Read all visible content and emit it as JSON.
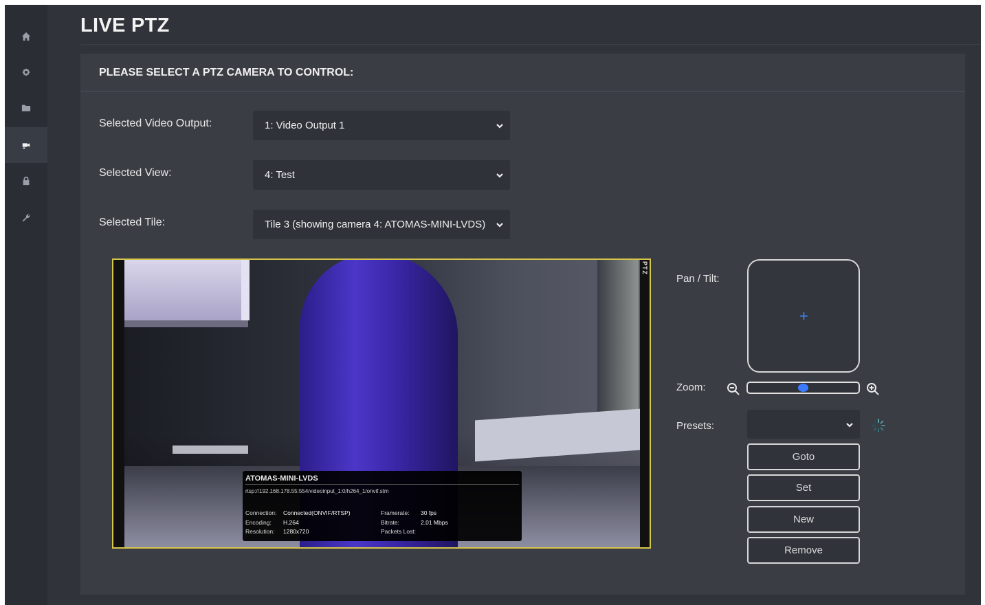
{
  "page": {
    "title": "LIVE PTZ"
  },
  "sidebar": {
    "items": [
      {
        "icon": "home-icon",
        "active": false
      },
      {
        "icon": "gear-icon",
        "active": false
      },
      {
        "icon": "folder-icon",
        "active": false
      },
      {
        "icon": "camera-icon",
        "active": true
      },
      {
        "icon": "lock-icon",
        "active": false
      },
      {
        "icon": "wrench-icon",
        "active": false
      }
    ]
  },
  "panel": {
    "heading": "PLEASE SELECT A PTZ CAMERA TO CONTROL:",
    "video_output": {
      "label": "Selected Video Output:",
      "value": "1: Video Output 1"
    },
    "view": {
      "label": "Selected View:",
      "value": "4: Test"
    },
    "tile": {
      "label": "Selected Tile:",
      "value": "Tile 3 (showing camera 4: ATOMAS-MINI-LVDS)"
    }
  },
  "video": {
    "ptz_badge": "PTZ",
    "camera_name": "ATOMAS-MINI-LVDS",
    "stream_url": "rtsp://192.168.178.55:554/videoinput_1:0/h264_1/onvif.stm",
    "stats": {
      "connection_label": "Connection:",
      "connection_value": "Connected(ONVIF/RTSP)",
      "encoding_label": "Encoding:",
      "encoding_value": "H.264",
      "resolution_label": "Resolution:",
      "resolution_value": "1280x720",
      "framerate_label": "Framerate:",
      "framerate_value": "30 fps",
      "bitrate_label": "Bitrate:",
      "bitrate_value": "2.01 Mbps",
      "packets_label": "Packets Lost:",
      "packets_value": ""
    }
  },
  "controls": {
    "pan_tilt_label": "Pan / Tilt:",
    "zoom_label": "Zoom:",
    "zoom_level": 0.5,
    "presets_label": "Presets:",
    "presets_value": "",
    "buttons": {
      "goto": "Goto",
      "set": "Set",
      "new": "New",
      "remove": "Remove"
    }
  },
  "colors": {
    "accent": "#3b7cff",
    "video_border": "#d6c64a"
  }
}
